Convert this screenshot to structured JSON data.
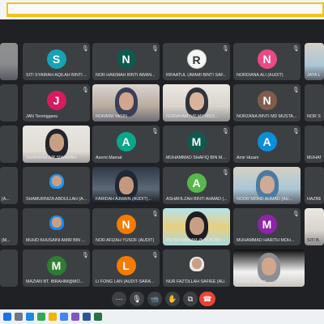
{
  "participants": [
    {
      "name": "SITI SYAIRAH AQILAH BINTI ...",
      "initial": "S",
      "color": "#15a3b6"
    },
    {
      "name": "NOR HAKIMAH BINTI AWAN...",
      "initial": "N",
      "color": "#0d5a4e"
    },
    {
      "name": "RIFAATUL UMAMI BINTI SAF...",
      "initial": "R",
      "color": "#f5f5f5"
    },
    {
      "name": "NORDIANA ALI (AUDIT)",
      "initial": "N",
      "color": "#e94a86"
    },
    {
      "name": "JAN Terengganu",
      "initial": "J",
      "color": "#d81b60"
    },
    {
      "name": "NORAINI YASIN",
      "initial": "",
      "color": ""
    },
    {
      "name": "NORIAYAM IVP MY MUS...",
      "initial": "",
      "color": ""
    },
    {
      "name": "NORZANA BINTI MD MUSTA...",
      "initial": "N",
      "color": "#7f5c4b"
    },
    {
      "name": "SHARIFAH AIP SIWARAH",
      "initial": "",
      "color": ""
    },
    {
      "name": "Azemi Mamat",
      "initial": "A",
      "color": "#0aa78b"
    },
    {
      "name": "MUHAMMAD SHAFIQ BIN M...",
      "initial": "M",
      "color": "#0d5a4e"
    },
    {
      "name": "Amir Hizam",
      "initial": "A",
      "color": "#0b8ed8"
    },
    {
      "name": "SHAMURNIZA ABDULLAH (A...",
      "initial": "",
      "color": ""
    },
    {
      "name": "FARIDAH AJMAIN (AUDIT)...",
      "initial": "",
      "color": ""
    },
    {
      "name": "ASHAFILZAH BINTI AHMAD (...",
      "initial": "A",
      "color": "#57b84b"
    },
    {
      "name": "NOOR MOHD AHMAD (AU...",
      "initial": "",
      "color": ""
    },
    {
      "name": "MUHD KHUSAINI AMIR BIN ...",
      "initial": "",
      "color": ""
    },
    {
      "name": "NOR AFIZAH YUSOF (AUDIT)",
      "initial": "N",
      "color": "#f57c00"
    },
    {
      "name": "PUTRI MARIAM @ NOR RU...",
      "initial": "",
      "color": ""
    },
    {
      "name": "MUHAMMAD HARITH MOH...",
      "initial": "M",
      "color": "#8e24aa"
    },
    {
      "name": "MAZIAN BT. IBRAHIM@MO...",
      "initial": "M",
      "color": "#2e7d32"
    },
    {
      "name": "LI FONG LAN (AUDIT-SARA...",
      "initial": "L",
      "color": "#f57c00"
    },
    {
      "name": "NUR FAZ'OLLAH SAFIEE (AU...",
      "initial": "",
      "color": ""
    },
    {
      "name": "Rifaatul Umami",
      "initial": "",
      "color": ""
    }
  ],
  "edge_names": {
    "right_row1": "JAYA L...",
    "right_row2": "NOR SYI...",
    "right_row3": "MUHAM...",
    "right_row4": "HAZREE...",
    "right_row5": "SITI B...",
    "left_row4": "(A...",
    "left_row5": "(M..."
  },
  "controls": {
    "more_label": "⋯",
    "mic_label": "🎙",
    "cam_label": "📹",
    "hand_label": "✋",
    "present_label": "⧉",
    "end_label": "☎"
  }
}
